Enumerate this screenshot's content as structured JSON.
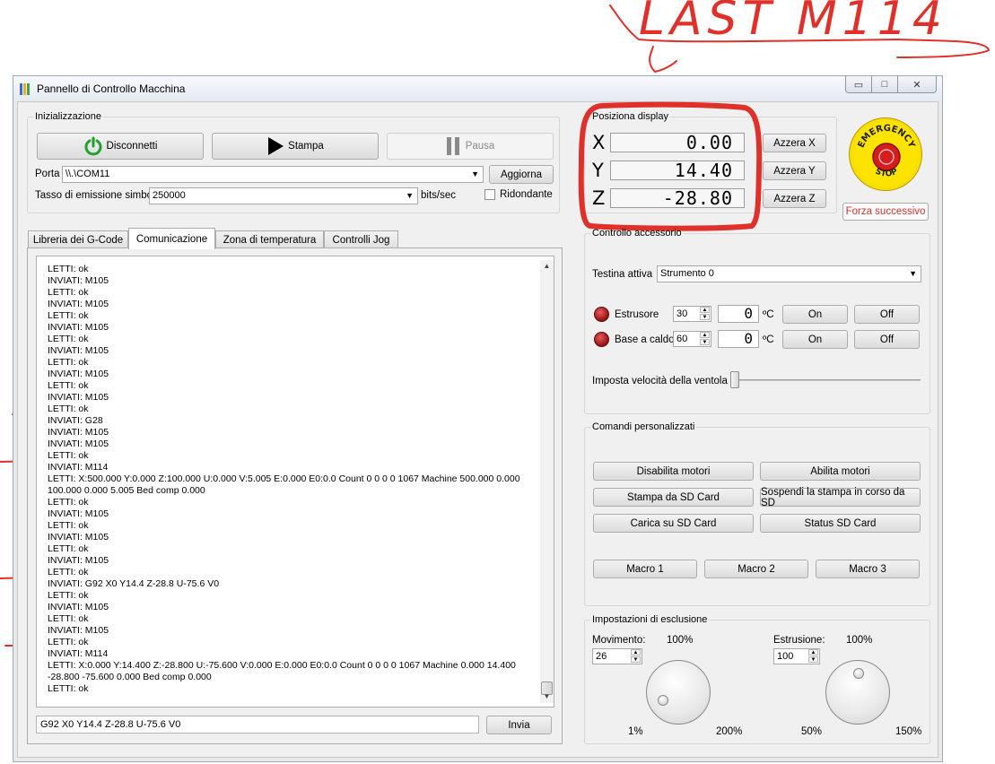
{
  "annotation_title": "LAST M114",
  "window": {
    "title": "Pannello di Controllo Macchina",
    "btn_minimize": "▭",
    "btn_maximize": "□",
    "btn_close": "✕"
  },
  "init": {
    "legend": "Inizializzazione",
    "disconnect_label": "Disconnetti",
    "print_label": "Stampa",
    "pause_label": "Pausa",
    "port_label": "Porta",
    "port_value": "\\\\.\\COM11",
    "refresh_label": "Aggiorna",
    "baud_label": "Tasso di emissione simboli",
    "baud_value": "250000",
    "baud_unit": "bits/sec",
    "redundant_label": "Ridondante"
  },
  "tabs": [
    "Libreria dei G-Code",
    "Comunicazione",
    "Zona di temperatura",
    "Controlli Jog"
  ],
  "active_tab": 1,
  "log": [
    "LETTI: ok",
    "INVIATI: M105",
    "LETTI: ok",
    "INVIATI: M105",
    "LETTI: ok",
    "INVIATI: M105",
    "LETTI: ok",
    "INVIATI: M105",
    "LETTI: ok",
    "INVIATI: M105",
    "LETTI: ok",
    "INVIATI: M105",
    "LETTI: ok",
    "INVIATI: G28",
    "INVIATI: M105",
    "INVIATI: M105",
    "LETTI: ok",
    "INVIATI: M114",
    "LETTI: X:500.000 Y:0.000 Z:100.000 U:0.000 V:5.005 E:0.000 E0:0.0 Count 0 0 0 0 1067 Machine 500.000 0.000 100.000 0.000 5.005 Bed comp 0.000",
    "LETTI: ok",
    "INVIATI: M105",
    "LETTI: ok",
    "INVIATI: M105",
    "LETTI: ok",
    "INVIATI: M105",
    "LETTI: ok",
    "INVIATI: G92 X0 Y14.4 Z-28.8 U-75.6 V0",
    "LETTI: ok",
    "INVIATI: M105",
    "LETTI: ok",
    "INVIATI: M105",
    "LETTI: ok",
    "INVIATI: M114",
    "LETTI: X:0.000 Y:14.400 Z:-28.800 U:-75.600 V:0.000 E:0.000 E0:0.0 Count 0 0 0 0 1067 Machine 0.000 14.400 -28.800 -75.600 0.000 Bed comp 0.000",
    "LETTI: ok"
  ],
  "command_input": "G92 X0 Y14.4 Z-28.8 U-75.6 V0",
  "send_label": "Invia",
  "position": {
    "legend": "Posiziona display",
    "axes": [
      {
        "letter": "X",
        "value": "0.00",
        "zero_label": "Azzera X"
      },
      {
        "letter": "Y",
        "value": "14.40",
        "zero_label": "Azzera Y"
      },
      {
        "letter": "Z",
        "value": "-28.80",
        "zero_label": "Azzera Z"
      }
    ]
  },
  "emergency": {
    "top_text": "EMERGENCY",
    "bottom_text": "STOP",
    "force_next_label": "Forza successivo"
  },
  "accessory": {
    "legend": "Controllo accessorio",
    "tool_label": "Testina attiva",
    "tool_value": "Strumento 0",
    "extruder_label": "Estrusore",
    "extruder_set": "30",
    "extruder_temp": "0",
    "bed_label": "Base a caldo",
    "bed_set": "60",
    "bed_temp": "0",
    "unit": "ºC",
    "on_label": "On",
    "off_label": "Off",
    "fan_label": "Imposta velocità della ventola",
    "fan_level": 0
  },
  "custom": {
    "legend": "Comandi personalizzati",
    "buttons": [
      "Disabilita motori",
      "Abilita motori",
      "Stampa da SD Card",
      "Sospendi la stampa in corso da SD",
      "Carica su SD Card",
      "Status SD Card"
    ],
    "macros": [
      "Macro 1",
      "Macro 2",
      "Macro 3"
    ]
  },
  "override": {
    "legend": "Impostazioni di esclusione",
    "movement_label": "Movimento:",
    "movement_pct": "100%",
    "movement_value": "26",
    "movement_min": "1%",
    "movement_max": "200%",
    "extrusion_label": "Estrusione:",
    "extrusion_pct": "100%",
    "extrusion_value": "100",
    "extrusion_min": "50%",
    "extrusion_max": "150%"
  }
}
